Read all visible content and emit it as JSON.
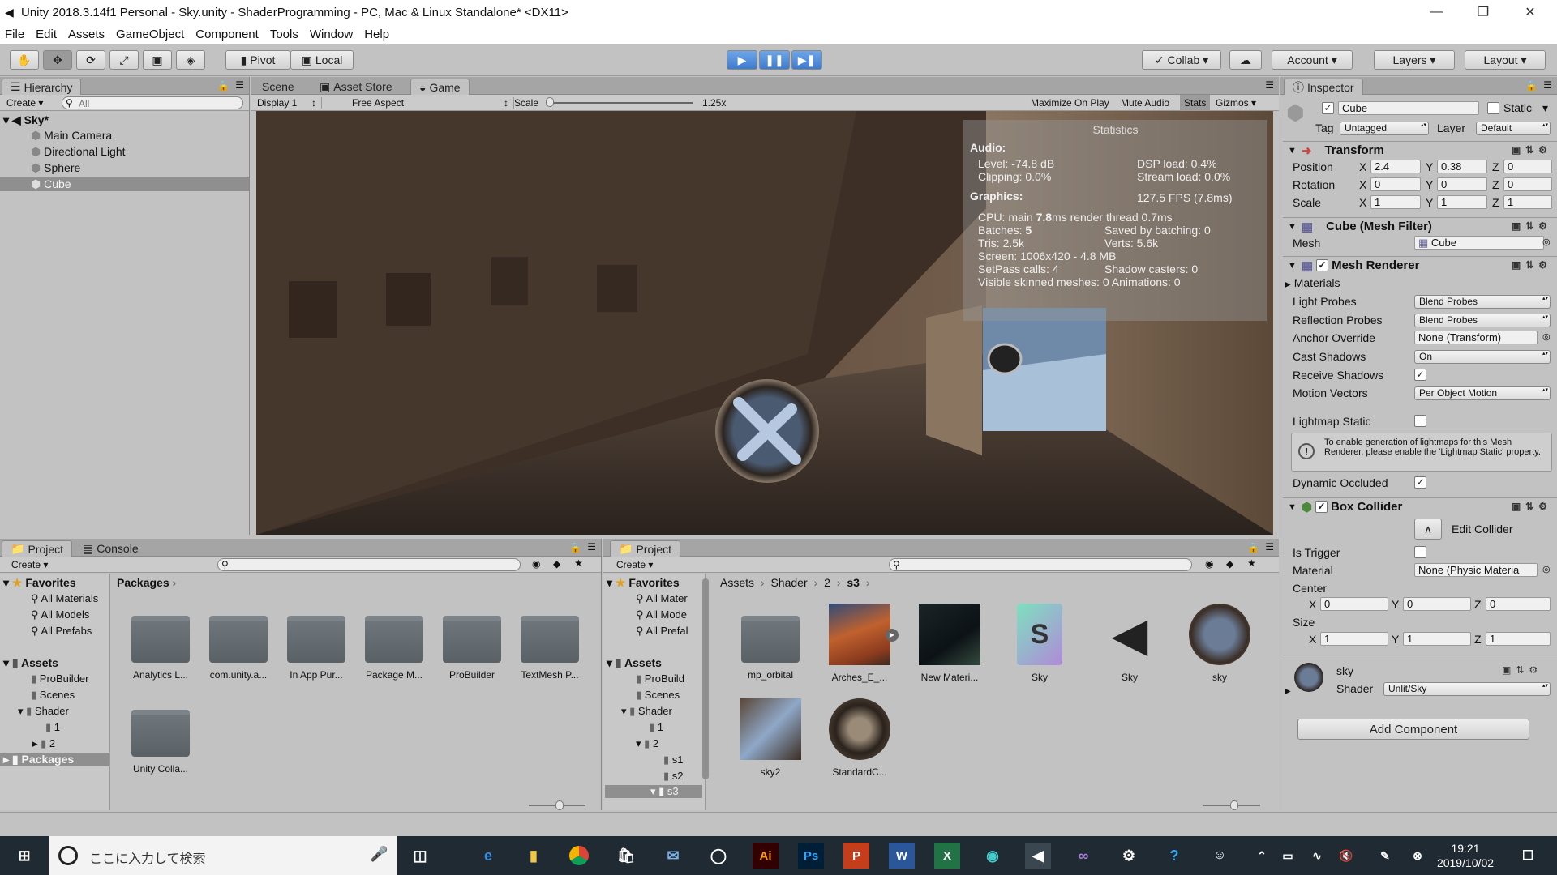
{
  "window": {
    "title": "Unity 2018.3.14f1 Personal - Sky.unity - ShaderProgramming - PC, Mac & Linux Standalone* <DX11>"
  },
  "menu": [
    "File",
    "Edit",
    "Assets",
    "GameObject",
    "Component",
    "Tools",
    "Window",
    "Help"
  ],
  "toolbar": {
    "pivot": "Pivot",
    "local": "Local",
    "collab": "Collab",
    "account": "Account",
    "layers": "Layers",
    "layout": "Layout"
  },
  "hierarchy": {
    "tab": "Hierarchy",
    "create": "Create",
    "search_placeholder": "All",
    "scene": "Sky*",
    "items": [
      "Main Camera",
      "Directional Light",
      "Sphere",
      "Cube"
    ],
    "selected": "Cube"
  },
  "view": {
    "tabs": [
      "Scene",
      "Asset Store",
      "Game"
    ],
    "active": "Game",
    "display": "Display 1",
    "aspect": "Free Aspect",
    "scale_label": "Scale",
    "scale_value": "1.25x",
    "toggles": [
      "Maximize On Play",
      "Mute Audio",
      "Stats",
      "Gizmos"
    ]
  },
  "stats": {
    "title": "Statistics",
    "audio_h": "Audio:",
    "level": "Level: -74.8 dB",
    "dsp": "DSP load: 0.4%",
    "clipping": "Clipping: 0.0%",
    "stream": "Stream load: 0.0%",
    "graphics_h": "Graphics:",
    "fps": "127.5 FPS (7.8ms)",
    "cpu_a": "CPU: main ",
    "cpu_b": "7.8",
    "cpu_c": "ms  render thread 0.7ms",
    "batches_a": "Batches: ",
    "batches_b": "5",
    "saved": "Saved by batching: 0",
    "tris": "Tris: 2.5k",
    "verts": "Verts: 5.6k",
    "screen": "Screen: 1006x420 - 4.8 MB",
    "setpass": "SetPass calls: 4",
    "shadow": "Shadow casters: 0",
    "skinned": "Visible skinned meshes: 0  Animations: 0"
  },
  "project_left": {
    "tabs": [
      "Project",
      "Console"
    ],
    "create": "Create",
    "favorites": "Favorites",
    "fav_items": [
      "All Materials",
      "All Models",
      "All Prefabs"
    ],
    "assets": "Assets",
    "asset_tree": [
      "ProBuilder",
      "Scenes",
      "Shader",
      "1",
      "2"
    ],
    "packages": "Packages",
    "crumb": "Packages",
    "folders": [
      "Analytics L...",
      "com.unity.a...",
      "In App Pur...",
      "Package M...",
      "ProBuilder",
      "TextMesh P...",
      "Unity Colla..."
    ]
  },
  "project_right": {
    "tab": "Project",
    "create": "Create",
    "favorites": "Favorites",
    "fav_items": [
      "All Mater",
      "All Mode",
      "All Prefal"
    ],
    "assets": "Assets",
    "tree": [
      "ProBuild",
      "Scenes",
      "Shader",
      "1",
      "2",
      "s1",
      "s2",
      "s3"
    ],
    "crumbs": [
      "Assets",
      "Shader",
      "2",
      "s3"
    ],
    "items": [
      "mp_orbital",
      "Arches_E_...",
      "New Materi...",
      "Sky",
      "Sky",
      "sky",
      "sky2",
      "StandardC..."
    ]
  },
  "inspector": {
    "tab": "Inspector",
    "name": "Cube",
    "static": "Static",
    "tag_label": "Tag",
    "tag": "Untagged",
    "layer_label": "Layer",
    "layer": "Default",
    "transform": {
      "title": "Transform",
      "rows": [
        {
          "label": "Position",
          "x": "2.4",
          "y": "0.38",
          "z": "0"
        },
        {
          "label": "Rotation",
          "x": "0",
          "y": "0",
          "z": "0"
        },
        {
          "label": "Scale",
          "x": "1",
          "y": "1",
          "z": "1"
        }
      ]
    },
    "mesh_filter": {
      "title": "Cube (Mesh Filter)",
      "mesh_label": "Mesh",
      "mesh": "Cube"
    },
    "mesh_renderer": {
      "title": "Mesh Renderer",
      "materials": "Materials",
      "light_probes": "Light Probes",
      "light_probes_v": "Blend Probes",
      "refl_probes": "Reflection Probes",
      "refl_probes_v": "Blend Probes",
      "anchor": "Anchor Override",
      "anchor_v": "None (Transform)",
      "cast": "Cast Shadows",
      "cast_v": "On",
      "receive": "Receive Shadows",
      "motion": "Motion Vectors",
      "motion_v": "Per Object Motion",
      "lightmap": "Lightmap Static",
      "info": "To enable generation of lightmaps for this Mesh Renderer, please enable the 'Lightmap Static' property.",
      "occluded": "Dynamic Occluded"
    },
    "box_collider": {
      "title": "Box Collider",
      "edit": "Edit Collider",
      "trigger": "Is Trigger",
      "material": "Material",
      "material_v": "None (Physic Materia",
      "center": "Center",
      "cx": "0",
      "cy": "0",
      "cz": "0",
      "size": "Size",
      "sx": "1",
      "sy": "1",
      "sz": "1"
    },
    "material": {
      "name": "sky",
      "shader_label": "Shader",
      "shader": "Unlit/Sky"
    },
    "add_component": "Add Component"
  },
  "taskbar": {
    "search": "ここに入力して検索",
    "time": "19:21",
    "date": "2019/10/02"
  },
  "axis": {
    "x": "X",
    "y": "Y",
    "z": "Z"
  }
}
